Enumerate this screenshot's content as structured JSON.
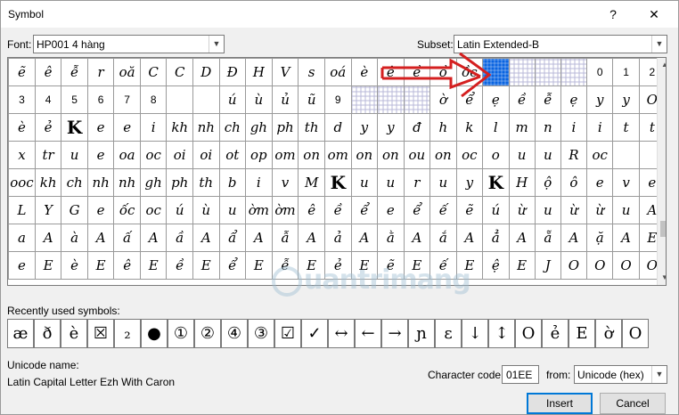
{
  "window": {
    "title": "Symbol",
    "help_label": "?",
    "close_label": "✕"
  },
  "font_label": "Font:",
  "font_value": "HP001 4 hàng",
  "subset_label": "Subset:",
  "subset_value": "Latin Extended-B",
  "grid_rows": [
    [
      "ẽ",
      "ê",
      "ễ",
      "r",
      "oă",
      "C",
      "C",
      "D",
      "Đ",
      "H",
      "V",
      "s",
      "oá",
      "è",
      "ê",
      "ề",
      "ồ",
      "ồc",
      "",
      "",
      "",
      "",
      "0",
      "1",
      "2"
    ],
    [
      "3",
      "4",
      "5",
      "6",
      "7",
      "8",
      "",
      "",
      "ú",
      "ù",
      "ủ",
      "ũ",
      "9",
      "",
      "",
      "",
      "ờ",
      "ể",
      "ẹ",
      "ề",
      "ễ",
      "ẹ",
      "y",
      "y",
      "O"
    ],
    [
      "è",
      "ẻ",
      "K",
      "e",
      "e",
      "i",
      "kh",
      "nh",
      "ch",
      "gh",
      "ph",
      "th",
      "d",
      "y",
      "y",
      "đ",
      "h",
      "k",
      "l",
      "m",
      "n",
      "i",
      "i",
      "t",
      "t"
    ],
    [
      "x",
      "tr",
      "u",
      "e",
      "oa",
      "oc",
      "oi",
      "oi",
      "ot",
      "op",
      "om",
      "on",
      "om",
      "on",
      "on",
      "ou",
      "on",
      "oc",
      "o",
      "u",
      "u",
      "R",
      "oc"
    ],
    [
      "ooc",
      "kh",
      "ch",
      "nh",
      "nh",
      "gh",
      "ph",
      "th",
      "b",
      "i",
      "v",
      "M",
      "K",
      "u",
      "u",
      "r",
      "u",
      "y",
      "K",
      "H",
      "ộ",
      "ô",
      "e",
      "v",
      "e"
    ],
    [
      "L",
      "Y",
      "G",
      "e",
      "ốc",
      "oc",
      "ú",
      "ù",
      "u",
      "ờm",
      "ờm",
      "ê",
      "ề",
      "ể",
      "e",
      "ể",
      "ế",
      "ẽ",
      "ú",
      "ừ",
      "u",
      "ừ",
      "ừ",
      "u",
      "A"
    ],
    [
      "a",
      "A",
      "à",
      "A",
      "ấ",
      "A",
      "ầ",
      "A",
      "ẩ",
      "A",
      "ẫ",
      "A",
      "ả",
      "A",
      "ằ",
      "A",
      "ắ",
      "A",
      "ẳ",
      "A",
      "ẵ",
      "A",
      "ặ",
      "A",
      "E"
    ],
    [
      "e",
      "E",
      "è",
      "E",
      "ê",
      "E",
      "ề",
      "E",
      "ể",
      "E",
      "ễ",
      "E",
      "ẻ",
      "E",
      "ẽ",
      "E",
      "ế",
      "E",
      "ệ",
      "E",
      "J",
      "O",
      "O",
      "O",
      "O"
    ]
  ],
  "recent_label": "Recently used symbols:",
  "recent_symbols": [
    "æ",
    "ð",
    "è",
    "☒",
    "₂",
    "●",
    "①",
    "②",
    "④",
    "③",
    "☑",
    "✓",
    "↔",
    "←",
    "→",
    "ɲ",
    "ɛ",
    "↓",
    "↕",
    "O",
    "ẻ",
    "E",
    "ờ",
    "O"
  ],
  "unicode_name_label": "Unicode name:",
  "unicode_name_value": "Latin Capital Letter Ezh With Caron",
  "charcode_label": "Character code:",
  "charcode_value": "01EE",
  "from_label": "from:",
  "from_value": "Unicode (hex)",
  "insert_label": "Insert",
  "cancel_label": "Cancel",
  "watermark_text": "uantrimang",
  "colors": {
    "selection": "#0a64e0",
    "annotation_arrow": "#d42020",
    "default_button_border": "#0078d7"
  }
}
